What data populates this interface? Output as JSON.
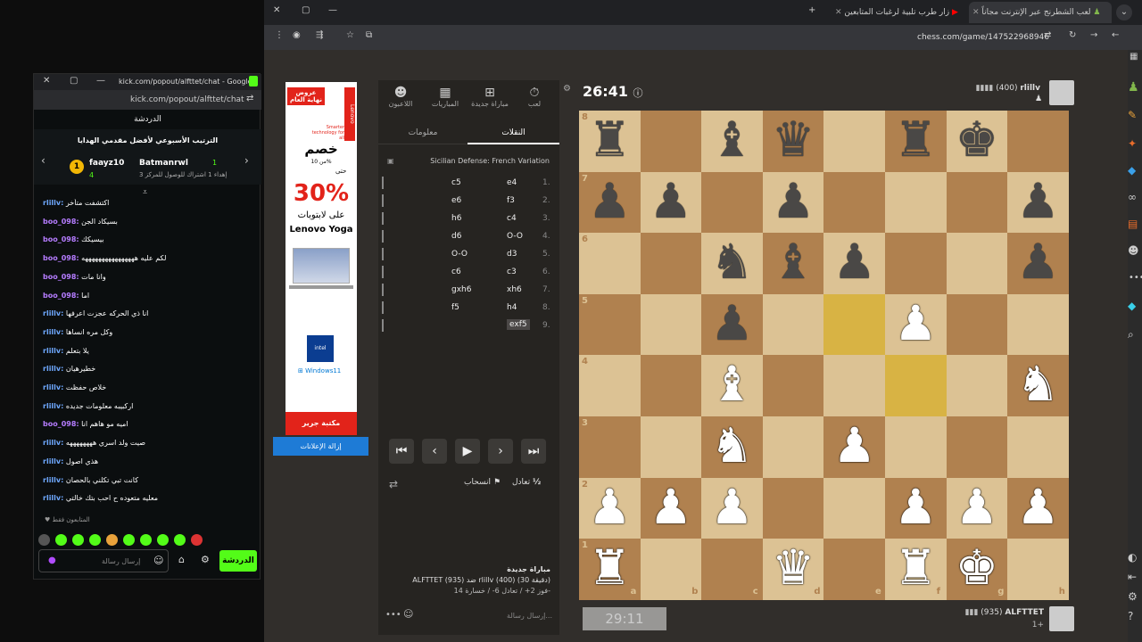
{
  "chat_window": {
    "title": "kick.com/popout/alfttet/chat - Google...",
    "url": "kick.com/popout/alfttet/chat",
    "header": "الدردشة",
    "leaderboard_title": "الترتيب الأسبوعي لأفضل مقدمي الهدايا",
    "leader1_name": "faayz10",
    "leader1_score": "4",
    "leader2_name": "Batmanrwl",
    "leader2_score": "1",
    "leader2_note": "إهداء 1 اشتراك للوصول للمركز 3",
    "messages": [
      {
        "user": "rlillv:",
        "text": "اكتشفت متأخر"
      },
      {
        "user": "boo_098:",
        "text": "بسيكاد الجن"
      },
      {
        "user": "boo_098:",
        "text": "بيسيكك"
      },
      {
        "user": "boo_098:",
        "text": "لكم عليه ههههههههههههههههه"
      },
      {
        "user": "boo_098:",
        "text": "وانا مات"
      },
      {
        "user": "boo_098:",
        "text": "اما"
      },
      {
        "user": "rlillv:",
        "text": "انا ذي الحركه عجزت اعرفها"
      },
      {
        "user": "rlillv:",
        "text": "وكل مره انساها"
      },
      {
        "user": "rlillv:",
        "text": "يلا بتعلم"
      },
      {
        "user": "rlillv:",
        "text": "خطيرهيان"
      },
      {
        "user": "rlillv:",
        "text": "خلاص حفظت"
      },
      {
        "user": "rlillv:",
        "text": "اركبيبه معلومات جديده"
      },
      {
        "user": "boo_098:",
        "text": "اميه مو هاهم انا"
      },
      {
        "user": "rlillv:",
        "text": "صيت ولد اسري ههههههههه"
      },
      {
        "user": "rlillv:",
        "text": "هذي اصول"
      },
      {
        "user": "rlillv:",
        "text": "كانت تبي تكلني بالحصان"
      },
      {
        "user": "rlillv:",
        "text": "معليه متعوده ح احب بتك خالتي"
      }
    ],
    "followers_only": "المتابعون فقط",
    "input_placeholder": "إرسال رسالة",
    "send_label": "الدردشة"
  },
  "browser": {
    "tabs": [
      "لعب الشطرنج عبر الإنترنت مجاناً",
      "زار طرب تلبية لرغبات المتابعين"
    ],
    "url": "chess.com/game/147522968946"
  },
  "ad": {
    "line1": "عروض",
    "line2": "نهاية العام",
    "brand_tag": "Smarter technology for all",
    "discount_label": "خصم",
    "discount_prefix": "حتى",
    "discount_from": "من 10%",
    "discount": "30%",
    "product": "على لابتوبات",
    "product_name": "Lenovo Yoga",
    "store": "مكتبة جرير",
    "remove_ads": "إزالة الإعلانات"
  },
  "panel": {
    "tabs": [
      "لعب",
      "مباراة جديدة",
      "المباريات",
      "اللاعبون"
    ],
    "subtab_moves": "النقلات",
    "subtab_info": "معلومات",
    "opening": "Sicilian Defense: French Variation",
    "moves": [
      {
        "n": "1.",
        "w": "e4",
        "b": "c5"
      },
      {
        "n": "2.",
        "w": "f3",
        "b": "e6"
      },
      {
        "n": "3.",
        "w": "c4",
        "b": "h6"
      },
      {
        "n": "4.",
        "w": "O-O",
        "b": "d6"
      },
      {
        "n": "5.",
        "w": "d3",
        "b": "O-O"
      },
      {
        "n": "6.",
        "w": "c3",
        "b": "c6"
      },
      {
        "n": "7.",
        "w": "xh6",
        "b": "gxh6"
      },
      {
        "n": "8.",
        "w": "h4",
        "b": "f5"
      },
      {
        "n": "9.",
        "w": "exf5",
        "b": ""
      }
    ],
    "draw_label": "تعادل",
    "draw_icon": "½",
    "resign_label": "انسحاب",
    "new_game_title": "مباراة جديدة",
    "game_line": "ALFTTET (935) ضد rlillv (400) (30 دقيقة)",
    "record": "فوز 2+ / تعادل 6- / خسارة 14-",
    "message_placeholder": "إرسال رسالة..."
  },
  "game": {
    "top_player": "rlillv",
    "top_rating": "(400)",
    "top_clock": "26:41",
    "bottom_player": "ALFTTET",
    "bottom_rating": "(935)",
    "bottom_extra": "1+",
    "bottom_clock": "29:11"
  },
  "board": {
    "files": [
      "a",
      "b",
      "c",
      "d",
      "e",
      "f",
      "g",
      "h"
    ],
    "ranks": [
      "8",
      "7",
      "6",
      "5",
      "4",
      "3",
      "2",
      "1"
    ],
    "position": [
      "r.bq.rk.",
      "pp.p...p",
      "..nbp..p",
      "..p..P..",
      "..B....N",
      "..N.P...",
      "PPP..PPP",
      "R..Q.RK."
    ],
    "highlight": [
      [
        3,
        4
      ],
      [
        4,
        5
      ]
    ]
  }
}
